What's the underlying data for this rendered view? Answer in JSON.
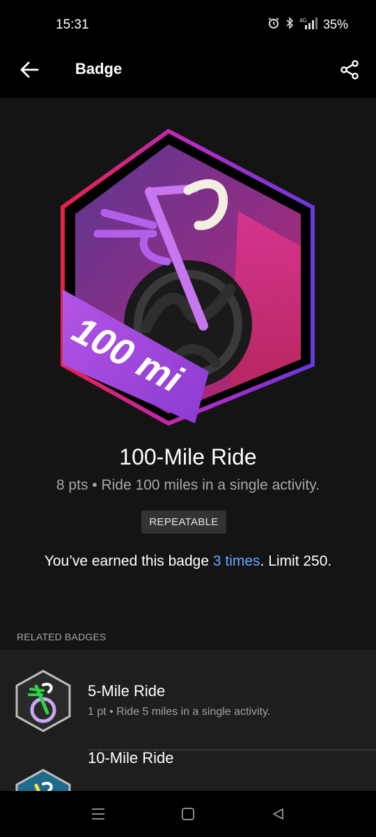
{
  "status": {
    "time": "15:31",
    "network": "4G",
    "battery": "35%"
  },
  "app_bar": {
    "title": "Badge"
  },
  "badge": {
    "art_label": "100 mi",
    "name": "100-Mile Ride",
    "description": "8 pts • Ride 100 miles in a single activity.",
    "chip": "REPEATABLE",
    "earned_prefix": "You’ve earned this badge ",
    "earned_count": "3 times",
    "earned_suffix": ". Limit 250."
  },
  "related": {
    "header": "RELATED BADGES",
    "items": [
      {
        "name": "5-Mile Ride",
        "description": "1 pt • Ride 5 miles in a single activity."
      },
      {
        "name": "10-Mile Ride",
        "description": ""
      }
    ]
  },
  "colors": {
    "accent_link": "#6aa8ff",
    "badge_purple": "#a64fe0",
    "badge_magenta": "#d9338a",
    "background": "#141414"
  }
}
